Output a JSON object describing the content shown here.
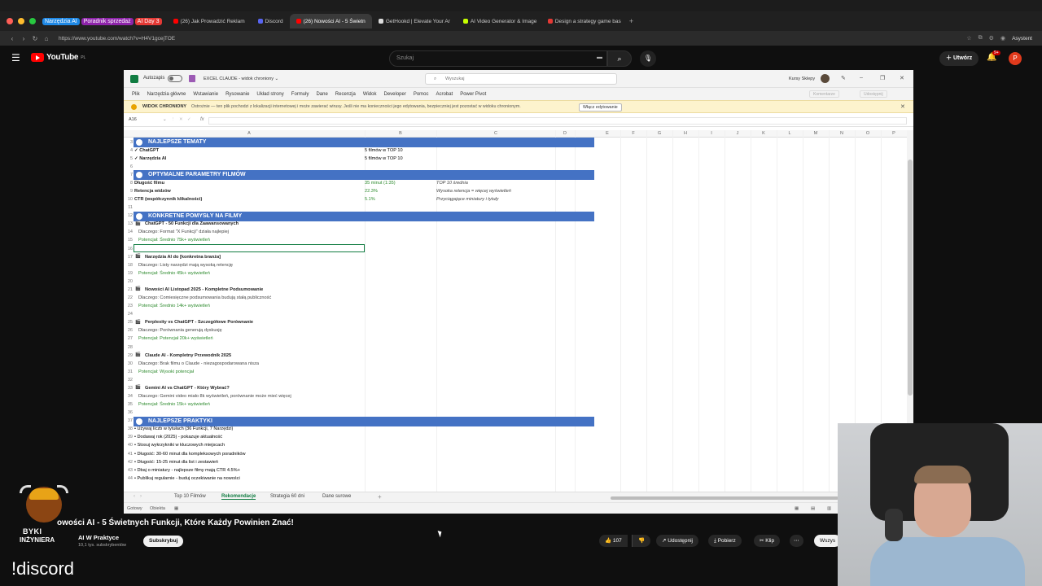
{
  "browser": {
    "pills": [
      {
        "label": "Narzędzia AI",
        "color": "#1e88e5"
      },
      {
        "label": "Poradnik sprzedaż",
        "color": "#8e24aa"
      },
      {
        "label": "AI Day 3",
        "color": "#e53935"
      }
    ],
    "tabs": [
      {
        "label": "(26) Jak Prowadzić Reklam",
        "icon": "youtube-icon",
        "color": "#ff0000"
      },
      {
        "label": "Discord",
        "icon": "discord-icon",
        "color": "#5865f2"
      },
      {
        "label": "(26) Nowości AI - 5 Świetn",
        "icon": "youtube-icon",
        "color": "#ff0000",
        "active": true
      },
      {
        "label": "GetHookd | Elevate Your Ar",
        "icon": "gethookd-icon",
        "color": "#dddddd"
      },
      {
        "label": "AI Video Generator & Image",
        "icon": "ai-video-icon",
        "color": "#c6ff00"
      },
      {
        "label": "Design a strategy game bas",
        "icon": "design-icon",
        "color": "#e53935"
      }
    ],
    "new_tab": "+",
    "url": "https://www.youtube.com/watch?v=H4V1gcejTOE",
    "assistant_label": "Asystent"
  },
  "youtube": {
    "logo_text": "YouTube",
    "logo_region": "PL",
    "search_placeholder": "Szukaj",
    "create_label": "Utwórz",
    "notif_badge": "9+",
    "avatar_letter": "P"
  },
  "excel": {
    "autosave_label": "Autozapis",
    "filename": "EXCEL CLAUDE - widok chroniony ⌄",
    "search_placeholder": "Wyszukaj",
    "user_name": "Kursy Sklepy",
    "menu": [
      "Plik",
      "Narzędzia główne",
      "Wstawianie",
      "Rysowanie",
      "Układ strony",
      "Formuły",
      "Dane",
      "Recenzja",
      "Widok",
      "Developer",
      "Pomoc",
      "Acrobat",
      "Power Pivot"
    ],
    "menu_right": [
      "Komentarze",
      "Udostępnij"
    ],
    "protected_label": "WIDOK CHRONIONY",
    "protected_msg": "Ostrożnie — ten plik pochodzi z lokalizacji internetowej i może zawierać wirusy. Jeśli nie ma konieczności jego edytowania, bezpieczniej jest pozostać w widoku chronionym.",
    "enable_editing": "Włącz edytowanie",
    "namebox": "A16",
    "fx": "fx",
    "columns": [
      "A",
      "B",
      "C",
      "D",
      "E",
      "F",
      "G",
      "H",
      "I",
      "J",
      "K",
      "L",
      "M",
      "N",
      "O",
      "P"
    ],
    "rows": [
      {
        "n": "3",
        "type": "header",
        "text": "NAJLEPSZE TEMATY"
      },
      {
        "n": "4",
        "a": "✓ ChatGPT",
        "b": "5 filmów w TOP 10"
      },
      {
        "n": "5",
        "a": "✓ Narzędzia AI",
        "b": "5 filmów w TOP 10"
      },
      {
        "n": "6"
      },
      {
        "n": "7",
        "type": "header",
        "text": "OPTYMALNE PARAMETRY FILMÓW"
      },
      {
        "n": "8",
        "a": "Długość filmu",
        "b": "35 minut (1:35)",
        "c": "TOP 10 średnia"
      },
      {
        "n": "9",
        "a": "Retencja widzów",
        "b": "22.3%",
        "c": "Wysoka retencja = więcej wyświetleń"
      },
      {
        "n": "10",
        "a": "CTR (współczynnik klikalności)",
        "b": "5.1%",
        "c": "Przyciągające miniatury i tytuły"
      },
      {
        "n": "11"
      },
      {
        "n": "12",
        "type": "header",
        "text": "KONKRETNE POMYSŁY NA FILMY"
      },
      {
        "n": "13",
        "type": "idea",
        "a": "ChatGPT - 50 Funkcji dla Zaawansowanych"
      },
      {
        "n": "14",
        "type": "why",
        "a": "Dlaczego: Format \"X Funkcji\" działa najlepiej"
      },
      {
        "n": "15",
        "type": "pot",
        "a": "Potencjał: Średnio 75k+ wyświetleń"
      },
      {
        "n": "16",
        "type": "selected"
      },
      {
        "n": "17",
        "type": "idea",
        "a": "Narzędzia AI do [konkretna branża]"
      },
      {
        "n": "18",
        "type": "why",
        "a": "Dlaczego: Listy narzędzi mają wysoką retencję"
      },
      {
        "n": "19",
        "type": "pot",
        "a": "Potencjał: Średnio 45k+ wyświetleń"
      },
      {
        "n": "20"
      },
      {
        "n": "21",
        "type": "idea",
        "a": "Nowości AI Listopad 2025 - Kompletne Podsumowanie"
      },
      {
        "n": "22",
        "type": "why",
        "a": "Dlaczego: Comiesięczne podsumowania budują stałą publiczność"
      },
      {
        "n": "23",
        "type": "pot",
        "a": "Potencjał: Średnio 14k+ wyświetleń"
      },
      {
        "n": "24"
      },
      {
        "n": "25",
        "type": "idea",
        "a": "Perplexity vs ChatGPT - Szczegółowe Porównanie"
      },
      {
        "n": "26",
        "type": "why",
        "a": "Dlaczego: Porównania generują dyskusję"
      },
      {
        "n": "27",
        "type": "pot",
        "a": "Potencjał: Potencjał 20k+ wyświetleń"
      },
      {
        "n": "28"
      },
      {
        "n": "29",
        "type": "idea",
        "a": "Claude AI - Kompletny Przewodnik 2025"
      },
      {
        "n": "30",
        "type": "why",
        "a": "Dlaczego: Brak filmu o Claude - niezagospodarowana nisza"
      },
      {
        "n": "31",
        "type": "pot",
        "a": "Potencjał: Wysoki potencjał"
      },
      {
        "n": "32"
      },
      {
        "n": "33",
        "type": "idea",
        "a": "Gemini AI vs ChatGPT - Który Wybrać?"
      },
      {
        "n": "34",
        "type": "why",
        "a": "Dlaczego: Gemini video miało 8k wyświetleń, porównanie może mieć więcej"
      },
      {
        "n": "35",
        "type": "pot",
        "a": "Potencjał: Średnio 15k+ wyświetleń"
      },
      {
        "n": "36"
      },
      {
        "n": "37",
        "type": "header",
        "text": "NAJLEPSZE PRAKTYKI"
      },
      {
        "n": "38",
        "a": "• Używaj liczb w tytułach (36 Funkcji, 7 Narzędzi)"
      },
      {
        "n": "39",
        "a": "• Dodawaj rok (2025) - pokazuje aktualność"
      },
      {
        "n": "40",
        "a": "• Stosuj wykrzykniki w kluczowych miejscach"
      },
      {
        "n": "41",
        "a": "• Długość: 30-60 minut dla kompleksowych poradników"
      },
      {
        "n": "42",
        "a": "• Długość: 15-25 minut dla list i zestawień"
      },
      {
        "n": "43",
        "a": "• Dbaj o miniatury - najlepsze filmy mają CTR 4.5%+"
      },
      {
        "n": "44",
        "a": "• Publikuj regularnie - buduj oczekiwanie na nowości"
      }
    ],
    "sheets": [
      "Top 10 Filmów",
      "Rekomendacje",
      "Strategia 60 dni",
      "Dane surowe"
    ],
    "active_sheet": "Rekomendacje",
    "add_sheet": "+",
    "status": [
      "Gotowy",
      "Obiekta"
    ]
  },
  "video": {
    "title": "Nowości AI - 5 Świetnych Funkcji, Które Każdy Powinien Znać!",
    "title_visible": "owości AI - 5 Świetnych Funkcji, Które Każdy Powinien Znać!",
    "channel_logo_line1": "BYKI",
    "channel_logo_line2": "INŻYNIERA",
    "channel_name": "AI W Praktyce",
    "channel_subs": "10,1 tys. subskrybentów",
    "subscribe_label": "Subskrybuj",
    "likes": "107",
    "share_label": "Udostępnij",
    "download_label": "Pobierz",
    "clip_label": "Klip",
    "more_label": "⋯",
    "all_label": "Wszys"
  },
  "overlay": {
    "discord_text": "!discord"
  }
}
